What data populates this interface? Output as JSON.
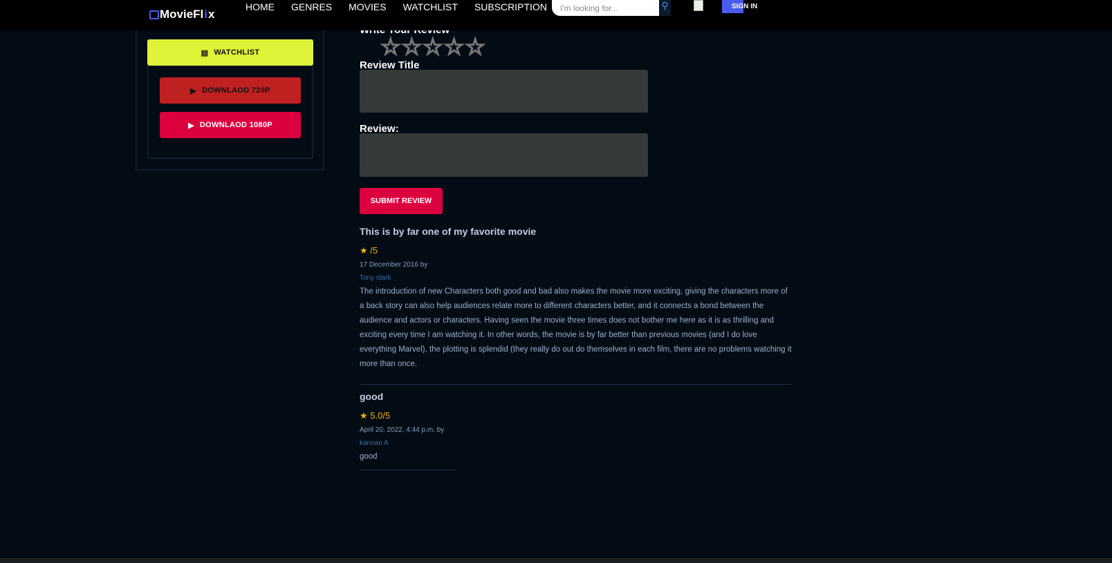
{
  "header": {
    "brand_prefix": "MovieFl",
    "brand_i": "i",
    "brand_suffix": "x",
    "nav": [
      "HOME",
      "GENRES",
      "MOVIES",
      "WATCHLIST",
      "SUBSCRIPTION"
    ],
    "search_placeholder": "I'm looking for...",
    "sign_in": "SIGN IN"
  },
  "sidebar": {
    "watchlist": "WATCHLIST",
    "download_720": "DOWNLAOD 720P",
    "download_1080": "DOWNLAOD 1080P"
  },
  "form": {
    "heading": "Write Your Review",
    "stars": "☆☆☆☆☆",
    "title_label": "Review Title",
    "review_label": "Review:",
    "submit": "SUBMIT REVIEW"
  },
  "reviews": [
    {
      "title": "This is by far one of my favorite movie",
      "rating": "/5",
      "date": "17 December 2016 by",
      "author": "Tony stark",
      "body": "The introduction of new Characters both good and bad also makes the movie more exciting, giving the characters more of a back story can also help audiences relate more to different characters better, and it connects a bond between the audience and actors or characters. Having seen the movie three times does not bother me here as it is as thrilling and exciting every time I am watching it. In other words, the movie is by far better than previous movies (and I do love everything Marvel), the plotting is splendid (they really do out do themselves in each film, there are no problems watching it more than once."
    },
    {
      "title": "good",
      "rating": "5.0/5",
      "date": "April 20, 2022, 4:44 p.m. by",
      "author": "kannan A",
      "body": "good"
    }
  ]
}
